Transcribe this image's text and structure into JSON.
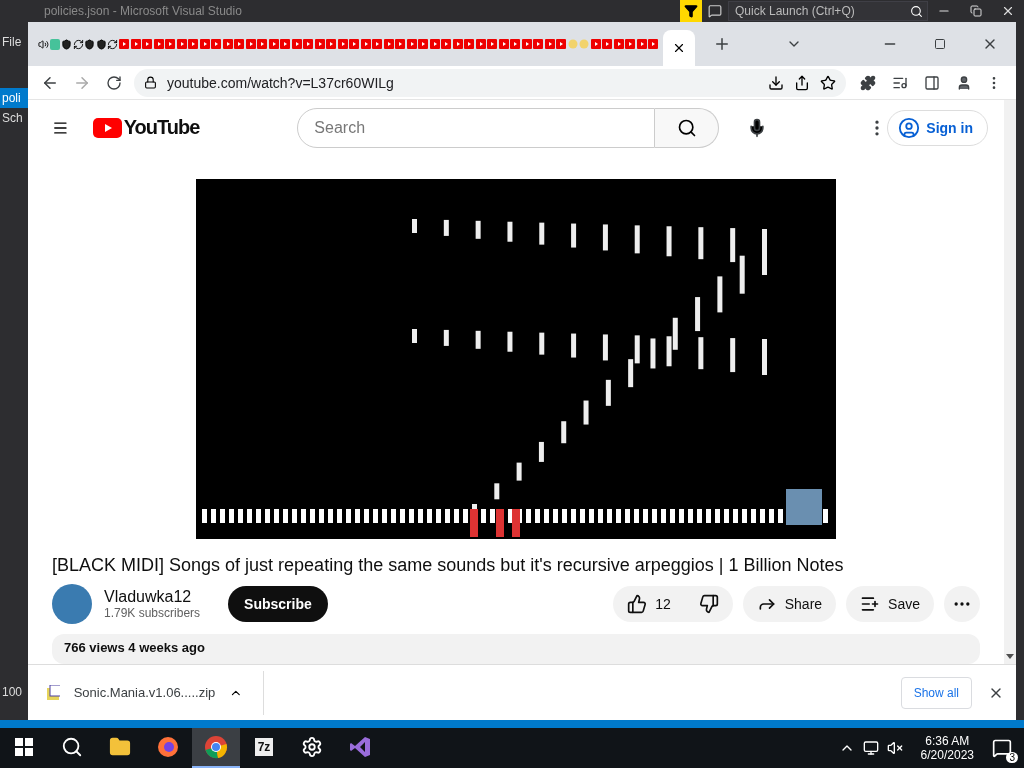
{
  "vs": {
    "title": "policies.json - Microsoft Visual Studio",
    "quick_launch": {
      "placeholder": "Quick Launch (Ctrl+Q)"
    },
    "side_labels": [
      {
        "text": "File",
        "selected": false
      },
      {
        "text": "poli",
        "selected": true
      },
      {
        "text": "Sch",
        "selected": false
      },
      {
        "text": "100",
        "selected": false
      }
    ]
  },
  "browser": {
    "tab_favicons": [
      {
        "kind": "audio"
      },
      {
        "kind": "green"
      },
      {
        "kind": "shield"
      },
      {
        "kind": "refresh"
      },
      {
        "kind": "shield"
      },
      {
        "kind": "shield"
      },
      {
        "kind": "refresh"
      },
      {
        "kind": "youtube"
      },
      {
        "kind": "youtube"
      },
      {
        "kind": "youtube"
      },
      {
        "kind": "youtube"
      },
      {
        "kind": "youtube"
      },
      {
        "kind": "youtube"
      },
      {
        "kind": "youtube"
      },
      {
        "kind": "youtube"
      },
      {
        "kind": "youtube"
      },
      {
        "kind": "youtube"
      },
      {
        "kind": "youtube"
      },
      {
        "kind": "youtube"
      },
      {
        "kind": "youtube"
      },
      {
        "kind": "youtube"
      },
      {
        "kind": "youtube"
      },
      {
        "kind": "youtube"
      },
      {
        "kind": "youtube"
      },
      {
        "kind": "youtube"
      },
      {
        "kind": "youtube"
      },
      {
        "kind": "youtube"
      },
      {
        "kind": "youtube"
      },
      {
        "kind": "youtube"
      },
      {
        "kind": "youtube"
      },
      {
        "kind": "youtube"
      },
      {
        "kind": "youtube"
      },
      {
        "kind": "youtube"
      },
      {
        "kind": "youtube"
      },
      {
        "kind": "youtube"
      },
      {
        "kind": "youtube"
      },
      {
        "kind": "youtube"
      },
      {
        "kind": "youtube"
      },
      {
        "kind": "youtube"
      },
      {
        "kind": "youtube"
      },
      {
        "kind": "youtube"
      },
      {
        "kind": "youtube"
      },
      {
        "kind": "youtube"
      },
      {
        "kind": "youtube"
      },
      {
        "kind": "youtube"
      },
      {
        "kind": "youtube"
      },
      {
        "kind": "yellow"
      },
      {
        "kind": "yellow"
      },
      {
        "kind": "youtube"
      },
      {
        "kind": "youtube"
      },
      {
        "kind": "youtube"
      },
      {
        "kind": "youtube"
      },
      {
        "kind": "youtube"
      },
      {
        "kind": "youtube"
      }
    ],
    "url": "youtube.com/watch?v=L37cr60WILg"
  },
  "youtube": {
    "logo_text": "YouTube",
    "search": {
      "placeholder": "Search"
    },
    "sign_in": "Sign in",
    "video_title": "[BLACK MIDI] Songs of just repeating the same sounds but it's recursive arpeggios | 1 Billion Notes",
    "channel": {
      "name": "Vladuwka12",
      "subscribers": "1.79K subscribers"
    },
    "subscribe": "Subscribe",
    "likes": "12",
    "share": "Share",
    "save": "Save",
    "meta": "766 views  4 weeks ago"
  },
  "download": {
    "file": "Sonic.Mania.v1.06.....zip",
    "show_all": "Show all"
  },
  "taskbar": {
    "apps": [
      {
        "kind": "search",
        "selected": false
      },
      {
        "kind": "explorer",
        "selected": false
      },
      {
        "kind": "firefox",
        "selected": false
      },
      {
        "kind": "chrome",
        "selected": true
      },
      {
        "kind": "archiver",
        "label": "7z",
        "selected": false
      },
      {
        "kind": "settings",
        "selected": false
      },
      {
        "kind": "studio",
        "selected": false
      }
    ],
    "time": "6:36 AM",
    "date": "6/20/2023",
    "notifications": "3"
  }
}
